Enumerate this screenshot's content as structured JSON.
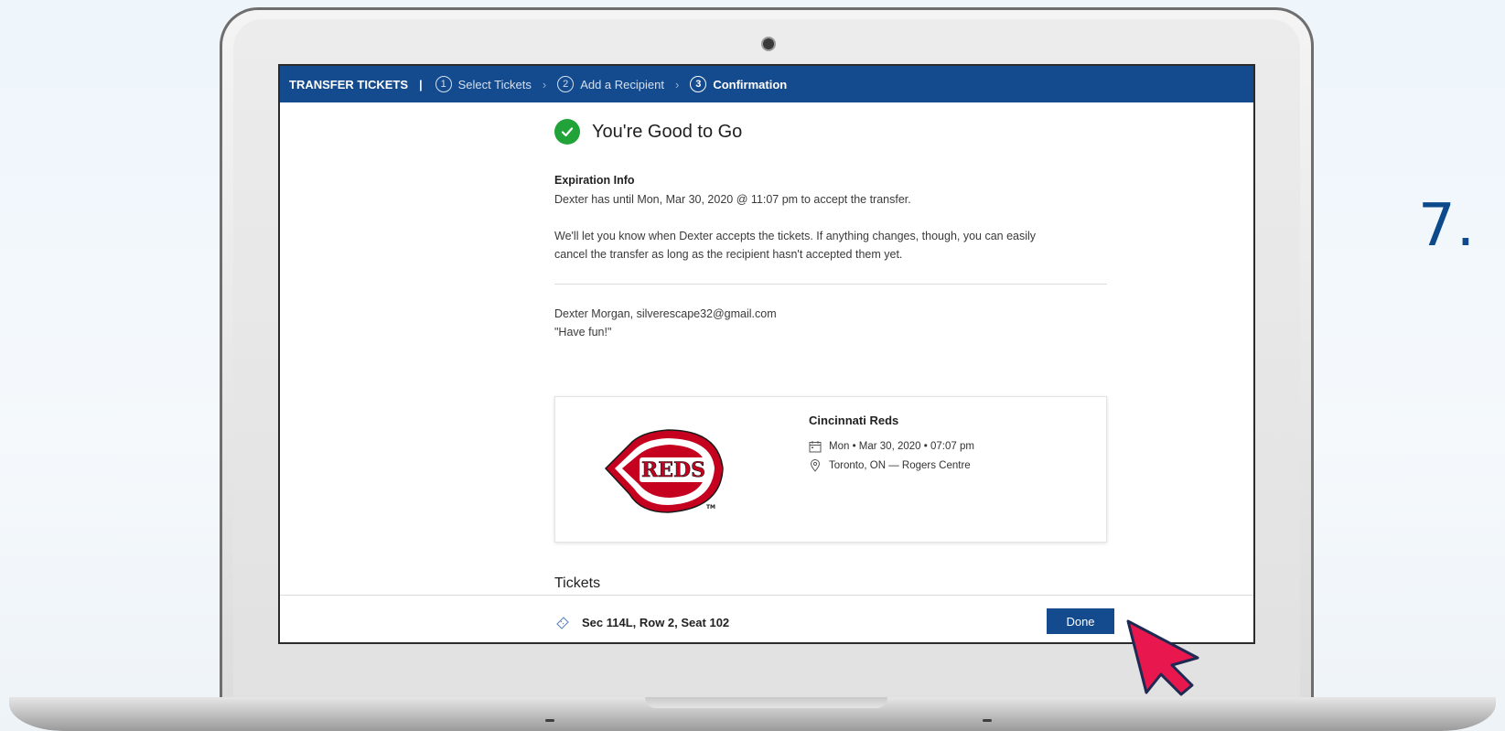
{
  "step_number": "7.",
  "topbar": {
    "brand": "TRANSFER TICKETS",
    "separator": "|",
    "steps": [
      {
        "num": "1",
        "label": "Select Tickets"
      },
      {
        "num": "2",
        "label": "Add a Recipient"
      },
      {
        "num": "3",
        "label": "Confirmation"
      }
    ]
  },
  "confirmation": {
    "title": "You're Good to Go",
    "expiration_heading": "Expiration Info",
    "expiration_text": "Dexter has until Mon, Mar 30, 2020 @ 11:07 pm to accept the transfer.",
    "notice_line1": "We'll let you know when Dexter accepts the tickets. If anything changes, though, you can easily",
    "notice_line2": "cancel the transfer as long as the recipient hasn't accepted them yet.",
    "recipient": "Dexter Morgan, silverescape32@gmail.com",
    "message": "\"Have fun!\""
  },
  "event": {
    "team": "Cincinnati Reds",
    "logo_text": "REDS",
    "logo_tm": "TM",
    "date": "Mon • Mar 30, 2020 • 07:07 pm",
    "venue": "Toronto, ON — Rogers Centre"
  },
  "tickets": {
    "heading": "Tickets",
    "items": [
      "Sec 114L, Row 2, Seat 102"
    ]
  },
  "footer": {
    "done_label": "Done"
  },
  "colors": {
    "brand_blue": "#144a8e",
    "success_green": "#21a33a",
    "reds_red": "#c6011f",
    "cursor_pink": "#e8184f"
  }
}
